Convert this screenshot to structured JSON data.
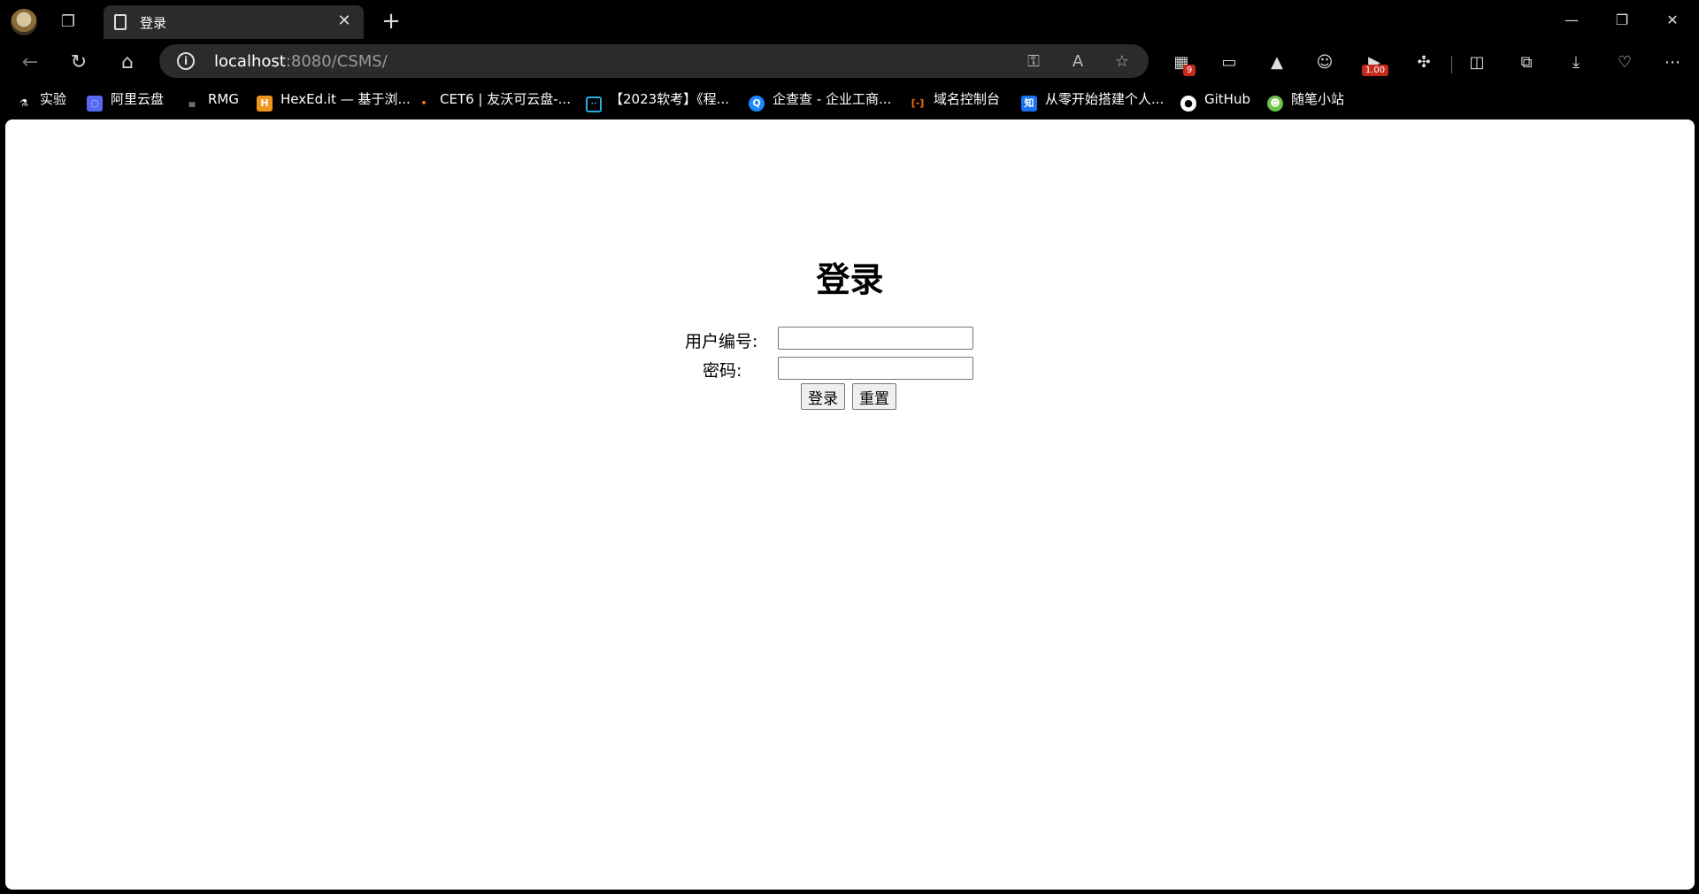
{
  "browser": {
    "tab": {
      "title": "登录"
    },
    "address": {
      "host": "localhost",
      "rest": ":8080/CSMS/"
    },
    "extensions": [
      {
        "name": "extension-badge-icon",
        "badge": "9"
      },
      {
        "name": "speed-extension-icon",
        "badge": "1.00"
      }
    ],
    "bookmarks": [
      {
        "label": "实验",
        "icon": "flask-icon",
        "color": "#ffffff"
      },
      {
        "label": "阿里云盘",
        "icon": "aliyun-drive-icon",
        "color": "#5a67f2"
      },
      {
        "label": "RMG",
        "icon": "rmg-icon",
        "color": "#888888"
      },
      {
        "label": "HexEd.it — 基于浏...",
        "icon": "hexedit-icon",
        "color": "#f0961f"
      },
      {
        "label": "CET6 | 友沃可云盘-...",
        "icon": "flame-icon",
        "color": "#ff7a00"
      },
      {
        "label": "【2023软考】《程...",
        "icon": "bilibili-icon",
        "color": "#23ade5"
      },
      {
        "label": "企查查 - 企业工商...",
        "icon": "qichacha-icon",
        "color": "#1e88ff"
      },
      {
        "label": "域名控制台",
        "icon": "aliyun-console-icon",
        "color": "#ff6a00"
      },
      {
        "label": "从零开始搭建个人...",
        "icon": "zhihu-icon",
        "color": "#1772f6"
      },
      {
        "label": "GitHub",
        "icon": "github-icon",
        "color": "#ffffff"
      },
      {
        "label": "随笔小站",
        "icon": "frog-icon",
        "color": "#6cc24a"
      }
    ]
  },
  "page": {
    "heading": "登录",
    "user_id_label": "用户编号:",
    "password_label": "密码:",
    "user_id_value": "",
    "password_value": "",
    "login_button": "登录",
    "reset_button": "重置"
  }
}
